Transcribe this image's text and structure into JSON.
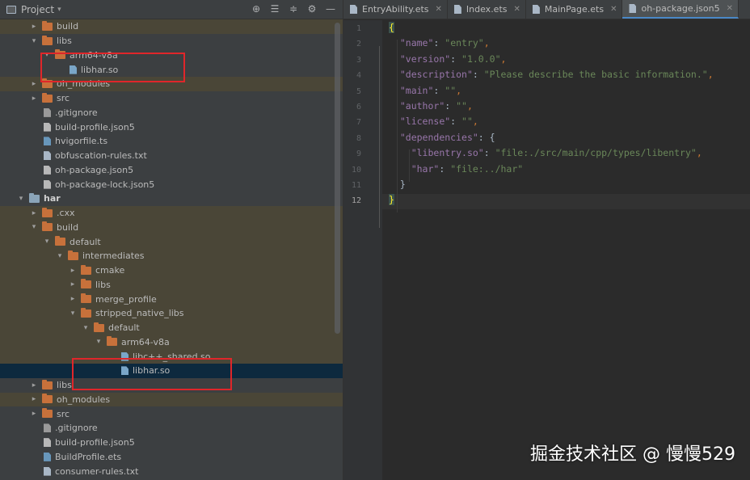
{
  "project_panel": {
    "title": "Project",
    "toolbar_icons": [
      "target-icon",
      "collapse-all-icon",
      "expand-all-icon",
      "settings-icon",
      "hide-icon"
    ]
  },
  "tree": [
    {
      "label": "build",
      "kind": "folder",
      "depth": 1,
      "state": "collapsed",
      "excluded": true
    },
    {
      "label": "libs",
      "kind": "folder",
      "depth": 1,
      "state": "expanded",
      "excluded": false
    },
    {
      "label": "arm64-v8a",
      "kind": "folder",
      "depth": 2,
      "state": "expanded",
      "excluded": false
    },
    {
      "label": "libhar.so",
      "kind": "file-so",
      "depth": 3,
      "state": "leaf",
      "excluded": false
    },
    {
      "label": "oh_modules",
      "kind": "folder",
      "depth": 1,
      "state": "collapsed",
      "excluded": true
    },
    {
      "label": "src",
      "kind": "folder",
      "depth": 1,
      "state": "collapsed",
      "excluded": false
    },
    {
      "label": ".gitignore",
      "kind": "file-git",
      "depth": 1,
      "state": "leaf",
      "excluded": false
    },
    {
      "label": "build-profile.json5",
      "kind": "file-json",
      "depth": 1,
      "state": "leaf",
      "excluded": false
    },
    {
      "label": "hvigorfile.ts",
      "kind": "file-ts",
      "depth": 1,
      "state": "leaf",
      "excluded": false
    },
    {
      "label": "obfuscation-rules.txt",
      "kind": "file-txt",
      "depth": 1,
      "state": "leaf",
      "excluded": false
    },
    {
      "label": "oh-package.json5",
      "kind": "file-json",
      "depth": 1,
      "state": "leaf",
      "excluded": false
    },
    {
      "label": "oh-package-lock.json5",
      "kind": "file-json",
      "depth": 1,
      "state": "leaf",
      "excluded": false
    },
    {
      "label": "har",
      "kind": "module",
      "depth": 0,
      "state": "expanded",
      "excluded": false,
      "bold": true
    },
    {
      "label": ".cxx",
      "kind": "folder",
      "depth": 1,
      "state": "collapsed",
      "excluded": true
    },
    {
      "label": "build",
      "kind": "folder",
      "depth": 1,
      "state": "expanded",
      "excluded": true
    },
    {
      "label": "default",
      "kind": "folder",
      "depth": 2,
      "state": "expanded",
      "excluded": true
    },
    {
      "label": "intermediates",
      "kind": "folder",
      "depth": 3,
      "state": "expanded",
      "excluded": true
    },
    {
      "label": "cmake",
      "kind": "folder",
      "depth": 4,
      "state": "collapsed",
      "excluded": true
    },
    {
      "label": "libs",
      "kind": "folder",
      "depth": 4,
      "state": "collapsed",
      "excluded": true
    },
    {
      "label": "merge_profile",
      "kind": "folder",
      "depth": 4,
      "state": "collapsed",
      "excluded": true
    },
    {
      "label": "stripped_native_libs",
      "kind": "folder",
      "depth": 4,
      "state": "expanded",
      "excluded": true
    },
    {
      "label": "default",
      "kind": "folder",
      "depth": 5,
      "state": "expanded",
      "excluded": true
    },
    {
      "label": "arm64-v8a",
      "kind": "folder",
      "depth": 6,
      "state": "expanded",
      "excluded": true
    },
    {
      "label": "libc++_shared.so",
      "kind": "file-so",
      "depth": 7,
      "state": "leaf",
      "excluded": true
    },
    {
      "label": "libhar.so",
      "kind": "file-so",
      "depth": 7,
      "state": "leaf",
      "excluded": false,
      "selected": true
    },
    {
      "label": "libs",
      "kind": "folder",
      "depth": 1,
      "state": "collapsed",
      "excluded": false
    },
    {
      "label": "oh_modules",
      "kind": "folder",
      "depth": 1,
      "state": "collapsed",
      "excluded": true
    },
    {
      "label": "src",
      "kind": "folder",
      "depth": 1,
      "state": "collapsed",
      "excluded": false
    },
    {
      "label": ".gitignore",
      "kind": "file-git",
      "depth": 1,
      "state": "leaf",
      "excluded": false
    },
    {
      "label": "build-profile.json5",
      "kind": "file-json",
      "depth": 1,
      "state": "leaf",
      "excluded": false
    },
    {
      "label": "BuildProfile.ets",
      "kind": "file-ts",
      "depth": 1,
      "state": "leaf",
      "excluded": false
    },
    {
      "label": "consumer-rules.txt",
      "kind": "file-txt",
      "depth": 1,
      "state": "leaf",
      "excluded": false
    }
  ],
  "editor": {
    "tabs": [
      {
        "label": "EntryAbility.ets",
        "active": false
      },
      {
        "label": "Index.ets",
        "active": false
      },
      {
        "label": "MainPage.ets",
        "active": false
      },
      {
        "label": "oh-package.json5",
        "active": true
      }
    ],
    "line_numbers": [
      "1",
      "2",
      "3",
      "4",
      "5",
      "6",
      "7",
      "8",
      "9",
      "10",
      "11",
      "12"
    ],
    "current_line": "12",
    "code": {
      "l1_brace": "{",
      "l2_key": "\"name\"",
      "l2_val": "\"entry\"",
      "l3_key": "\"version\"",
      "l3_val": "\"1.0.0\"",
      "l4_key": "\"description\"",
      "l4_val": "\"Please describe the basic information.\"",
      "l5_key": "\"main\"",
      "l5_val": "\"\"",
      "l6_key": "\"author\"",
      "l6_val": "\"\"",
      "l7_key": "\"license\"",
      "l7_val": "\"\"",
      "l8_key": "\"dependencies\"",
      "l8_open": "{",
      "l9_key": "\"libentry.so\"",
      "l9_val": "\"file:./src/main/cpp/types/libentry\"",
      "l10_key": "\"har\"",
      "l10_val": "\"file:../har\"",
      "l11_close": "}",
      "l12_brace": "}"
    }
  },
  "watermark": "掘金技术社区 @ 慢慢529"
}
